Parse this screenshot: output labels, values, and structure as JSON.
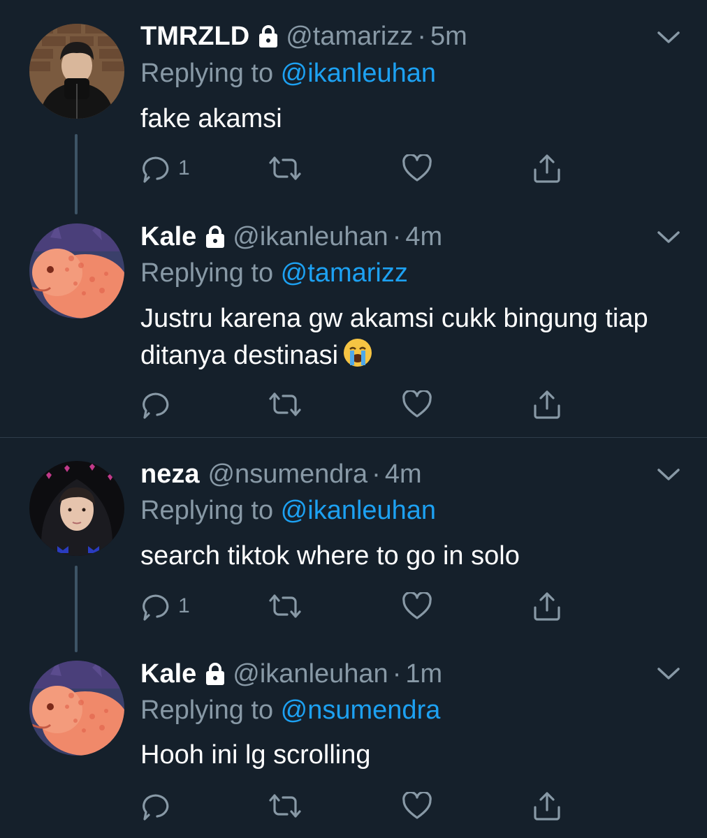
{
  "colors": {
    "background": "#15202b",
    "text_primary": "#ffffff",
    "text_secondary": "#8899a6",
    "link": "#1da1f2",
    "thread_line": "#3d5466"
  },
  "tweets": [
    {
      "display_name": "TMRZLD",
      "protected": true,
      "handle": "@tamarizz",
      "dot": "·",
      "time": "5m",
      "replying_prefix": "Replying to ",
      "replying_to": "@ikanleuhan",
      "text": "fake akamsi",
      "reply_count": "1",
      "avatar_icon": "person-black-jacket-avatar"
    },
    {
      "display_name": "Kale",
      "protected": true,
      "handle": "@ikanleuhan",
      "dot": "·",
      "time": "4m",
      "replying_prefix": "Replying to ",
      "replying_to": "@tamarizz",
      "text": "Justru karena gw akamsi cukk bingung tiap ditanya destinasi",
      "emoji": "loudly-crying-face-emoji",
      "reply_count": "",
      "avatar_icon": "orange-fish-avatar"
    },
    {
      "display_name": "neza",
      "protected": false,
      "handle": "@nsumendra",
      "dot": "·",
      "time": "4m",
      "replying_prefix": "Replying to ",
      "replying_to": "@ikanleuhan",
      "text": "search tiktok where to go in solo",
      "reply_count": "1",
      "avatar_icon": "person-hoodie-avatar"
    },
    {
      "display_name": "Kale",
      "protected": true,
      "handle": "@ikanleuhan",
      "dot": "·",
      "time": "1m",
      "replying_prefix": "Replying to ",
      "replying_to": "@nsumendra",
      "text": "Hooh ini lg scrolling",
      "reply_count": "",
      "avatar_icon": "orange-fish-avatar"
    }
  ]
}
